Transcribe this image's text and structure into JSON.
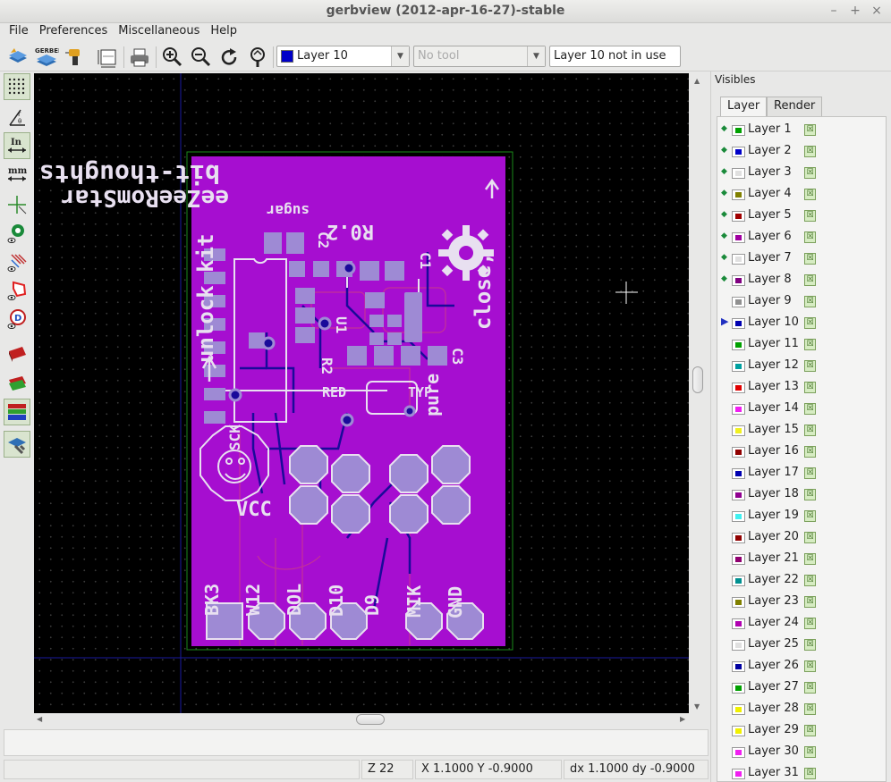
{
  "window": {
    "title": "gerbview (2012-apr-16-27)-stable"
  },
  "menu": [
    "File",
    "Preferences",
    "Miscellaneous",
    "Help"
  ],
  "toolbar": {
    "layer_select": {
      "value": "Layer 10",
      "color": "#0000c8"
    },
    "tool_select": {
      "value": "No tool"
    },
    "layer_status": "Layer 10 not in use"
  },
  "panel": {
    "title": "Visibles",
    "tabs": [
      "Layer",
      "Render"
    ],
    "layers": [
      {
        "name": "Layer 1",
        "color": "#00a000",
        "visible_mark": "diamond"
      },
      {
        "name": "Layer 2",
        "color": "#0000c8",
        "visible_mark": "diamond"
      },
      {
        "name": "Layer 3",
        "color": "#e0e0e0",
        "visible_mark": "diamond"
      },
      {
        "name": "Layer 4",
        "color": "#808000",
        "visible_mark": "diamond"
      },
      {
        "name": "Layer 5",
        "color": "#a00000",
        "visible_mark": "diamond"
      },
      {
        "name": "Layer 6",
        "color": "#a000a0",
        "visible_mark": "diamond"
      },
      {
        "name": "Layer 7",
        "color": "#e0e0e0",
        "visible_mark": "diamond"
      },
      {
        "name": "Layer 8",
        "color": "#800080",
        "visible_mark": "diamond"
      },
      {
        "name": "Layer 9",
        "color": "#909090",
        "visible_mark": "none"
      },
      {
        "name": "Layer 10",
        "color": "#0000b0",
        "visible_mark": "arrow"
      },
      {
        "name": "Layer 11",
        "color": "#00a000",
        "visible_mark": "none"
      },
      {
        "name": "Layer 12",
        "color": "#00a0a0",
        "visible_mark": "none"
      },
      {
        "name": "Layer 13",
        "color": "#e00000",
        "visible_mark": "none"
      },
      {
        "name": "Layer 14",
        "color": "#f020f0",
        "visible_mark": "none"
      },
      {
        "name": "Layer 15",
        "color": "#f0f020",
        "visible_mark": "none"
      },
      {
        "name": "Layer 16",
        "color": "#900000",
        "visible_mark": "none"
      },
      {
        "name": "Layer 17",
        "color": "#0000b0",
        "visible_mark": "none"
      },
      {
        "name": "Layer 18",
        "color": "#900090",
        "visible_mark": "none"
      },
      {
        "name": "Layer 19",
        "color": "#40f0f0",
        "visible_mark": "none"
      },
      {
        "name": "Layer 20",
        "color": "#900000",
        "visible_mark": "none"
      },
      {
        "name": "Layer 21",
        "color": "#900070",
        "visible_mark": "none"
      },
      {
        "name": "Layer 22",
        "color": "#009090",
        "visible_mark": "none"
      },
      {
        "name": "Layer 23",
        "color": "#808000",
        "visible_mark": "none"
      },
      {
        "name": "Layer 24",
        "color": "#b000b0",
        "visible_mark": "none"
      },
      {
        "name": "Layer 25",
        "color": "#e0e0e0",
        "visible_mark": "none"
      },
      {
        "name": "Layer 26",
        "color": "#0000a0",
        "visible_mark": "none"
      },
      {
        "name": "Layer 27",
        "color": "#00a000",
        "visible_mark": "none"
      },
      {
        "name": "Layer 28",
        "color": "#f0f000",
        "visible_mark": "none"
      },
      {
        "name": "Layer 29",
        "color": "#f0f000",
        "visible_mark": "none"
      },
      {
        "name": "Layer 30",
        "color": "#f020f0",
        "visible_mark": "none"
      },
      {
        "name": "Layer 31",
        "color": "#f020f0",
        "visible_mark": "none"
      }
    ]
  },
  "status": {
    "zoom": "Z 22",
    "abs_coords": "X 1.1000  Y -0.9000",
    "rel_coords": "dx 1.1000  dy -0.9000"
  },
  "board": {
    "silk_text": {
      "top_url": "bit-thoughts.com",
      "product": "eeZeeRomStar",
      "name2": "sugar",
      "rev": "R0.2",
      "unlock": "unlock kit",
      "close": "close,",
      "pure": "pure",
      "u1": "U1",
      "r2": "R2",
      "c1": "C1",
      "c2": "C2",
      "c3": "C3",
      "red": "RED",
      "typ": "TYP",
      "d9": "D9",
      "gnd": "GND",
      "mik": "MIK",
      "d10": "D10",
      "dol": "DOL",
      "w12": "W12",
      "bk3": "BK3",
      "vcc": "VCC",
      "sck": "SCK"
    }
  }
}
